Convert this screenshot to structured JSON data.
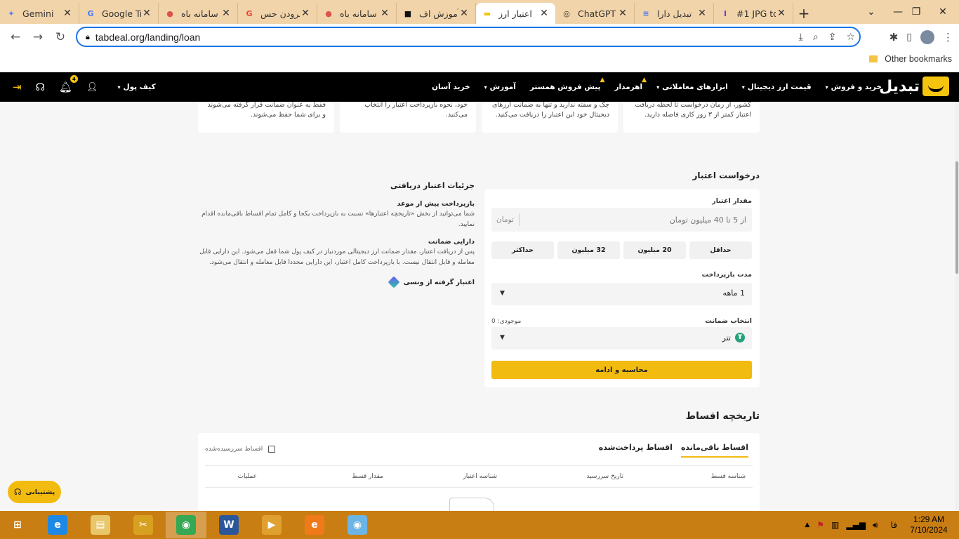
{
  "browser": {
    "tabs": [
      {
        "title": "Gemini",
        "icon": "gemini-icon",
        "color": "#4a7cf5",
        "glyph": "✦"
      },
      {
        "title": "Google Tr",
        "icon": "google-translate-icon",
        "color": "#4a7cf5",
        "glyph": "G"
      },
      {
        "title": "سامانه باه",
        "icon": "emblem-icon",
        "color": "#d9534f",
        "glyph": "●"
      },
      {
        "title": "فرودن حس",
        "icon": "google-icon",
        "color": "#ea4335",
        "glyph": "G"
      },
      {
        "title": "سامانه باه",
        "icon": "emblem-icon",
        "color": "#d9534f",
        "glyph": "●"
      },
      {
        "title": "آموزش اف",
        "icon": "app-icon",
        "color": "#111111",
        "glyph": "■"
      },
      {
        "title": "اعتبار ارز",
        "icon": "tabdeal-icon",
        "color": "#f5c40e",
        "glyph": "▬",
        "active": true
      },
      {
        "title": "ChatGPT",
        "icon": "chatgpt-icon",
        "color": "#333333",
        "glyph": "◎"
      },
      {
        "title": "تبدیل دارا",
        "icon": "docs-icon",
        "color": "#4a7cf5",
        "glyph": "≡"
      },
      {
        "title": "#1 JPG to",
        "icon": "converter-icon",
        "color": "#6b3fd4",
        "glyph": "I"
      }
    ],
    "url": "tabdeal.org/landing/loan",
    "other_bookmarks": "Other bookmarks"
  },
  "site": {
    "logo_text": "تبدیل",
    "nav": [
      {
        "label": "خرید و فروش",
        "caret": true
      },
      {
        "label": "قیمت ارز دیجیتال",
        "caret": true
      },
      {
        "label": "ابزارهای معاملاتی",
        "caret": true
      },
      {
        "label": "اهرمدار",
        "fire": true
      },
      {
        "label": "پیش فروش همستر",
        "fire": true
      },
      {
        "label": "آموزش",
        "caret": true
      },
      {
        "label": "خرید آسان"
      }
    ],
    "notification_count": "4",
    "wallet_label": "کیف پول"
  },
  "features": [
    {
      "text": "کشور، از زمان درخواست تا لحظه دریافت اعتبار کمتر از ۳ روز کاری فاصله دارید."
    },
    {
      "text": "چک و سفته ندارید و تنها به ضمانت ارزهای دیجیتال خود این اعتبار را دریافت می‌کنید."
    },
    {
      "text": "خود، نحوه بازپرداخت اعتبار را انتخاب می‌کنید."
    },
    {
      "text": "فقط به عنوان ضمانت قرار گرفته می‌شوند و برای شما حفظ می‌شوند."
    }
  ],
  "request": {
    "title": "درخواست اعتبار",
    "amount_label": "مقدار اعتبار",
    "amount_placeholder": "از 5 تا 40 میلیون تومان",
    "unit": "تومان",
    "quick": [
      "حداقل",
      "20 میلیون",
      "32 میلیون",
      "حداکثر"
    ],
    "duration_label": "مدت بازپرداخت",
    "duration_value": "1 ماهه",
    "collateral_label": "انتخاب ضمانت",
    "balance": "موجودی: 0",
    "collateral_value": "تتر",
    "submit": "محاسبه و ادامه"
  },
  "details": {
    "title": "جزئیات اعتبار دریافتی",
    "items": [
      {
        "heading": "بازپرداخت پیش از موعد",
        "text": "شما می‌توانید از بخش «تاریخچه اعتبارها» نسبت به بازپرداخت یکجا و کامل تمام اقساط باقی‌مانده اقدام نمایید."
      },
      {
        "heading": "دارایی ضمانت",
        "text": "پس از دریافت اعتبار، مقدار ضمانت ارز دیجیتالی موردنیاز در کیف پول شما قفل می‌شود. این دارایی قابل معامله و قابل انتقال نیست. با بازپرداخت کامل اعتبار، این دارایی مجددا قابل معامله و انتقال می‌شود."
      }
    ],
    "credit_link": "اعتبار گرفته از ونسی"
  },
  "history": {
    "title": "تاریخچه اقساط",
    "tabs": [
      "اقساط باقی‌مانده",
      "اقساط پرداخت‌شده"
    ],
    "overdue_label": "اقساط سررسیده‌شده",
    "columns": [
      "شناسه قسط",
      "تاریخ سررسید",
      "شناسه اعتبار",
      "مقدار قسط",
      "عملیات"
    ]
  },
  "support_label": "پشتیبانی",
  "taskbar": {
    "apps": [
      {
        "name": "windows-start",
        "glyph": "⊞",
        "color": "#c97e14"
      },
      {
        "name": "internet-explorer",
        "glyph": "e",
        "color": "#1e88e5"
      },
      {
        "name": "file-explorer",
        "glyph": "▤",
        "color": "#e8c76a"
      },
      {
        "name": "tools",
        "glyph": "✂",
        "color": "#d8a020"
      },
      {
        "name": "chrome",
        "glyph": "◉",
        "color": "#34a853",
        "active": true
      },
      {
        "name": "word",
        "glyph": "W",
        "color": "#2b579a"
      },
      {
        "name": "media-player",
        "glyph": "▶",
        "color": "#e0a030"
      },
      {
        "name": "messenger",
        "glyph": "e",
        "color": "#f07a1a"
      },
      {
        "name": "eye-app",
        "glyph": "◉",
        "color": "#6cb4e4"
      }
    ],
    "lang": "فا",
    "time": "1:29 AM",
    "date": "7/10/2024"
  }
}
